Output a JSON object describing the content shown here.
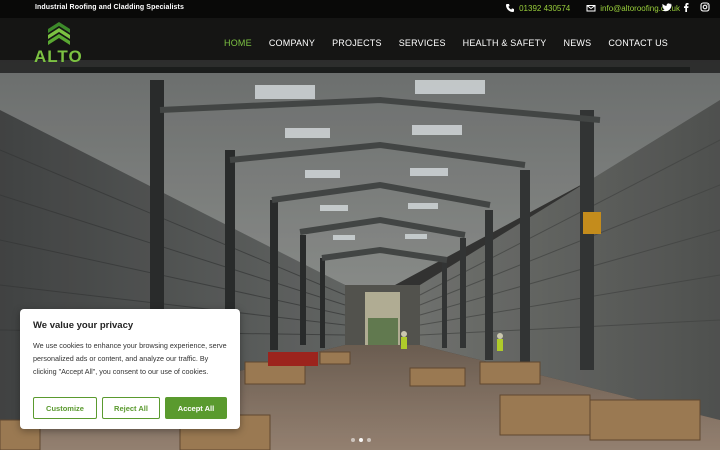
{
  "topbar": {
    "tagline": "Industrial Roofing and Cladding Specialists",
    "phone": "01392 430574",
    "email": "info@altoroofing.co.uk",
    "social": [
      "twitter-icon",
      "facebook-icon",
      "instagram-icon"
    ]
  },
  "header": {
    "logo_text": "ALTO",
    "nav": [
      "HOME",
      "COMPANY",
      "PROJECTS",
      "SERVICES",
      "HEALTH & SAFETY",
      "NEWS",
      "CONTACT US"
    ],
    "active_nav": "HOME"
  },
  "cookie": {
    "title": "We value your privacy",
    "body": "We use cookies to enhance your browsing experience, serve personalized ads or content, and analyze our traffic. By clicking \"Accept All\", you consent to our use of cookies.",
    "customize": "Customize",
    "reject": "Reject All",
    "accept": "Accept All"
  },
  "slider": {
    "dot_count": 3,
    "active_index": 1
  },
  "colors": {
    "brand_green": "#7cc242",
    "button_green": "#5a9a2e",
    "topbar_bg": "#000000"
  }
}
